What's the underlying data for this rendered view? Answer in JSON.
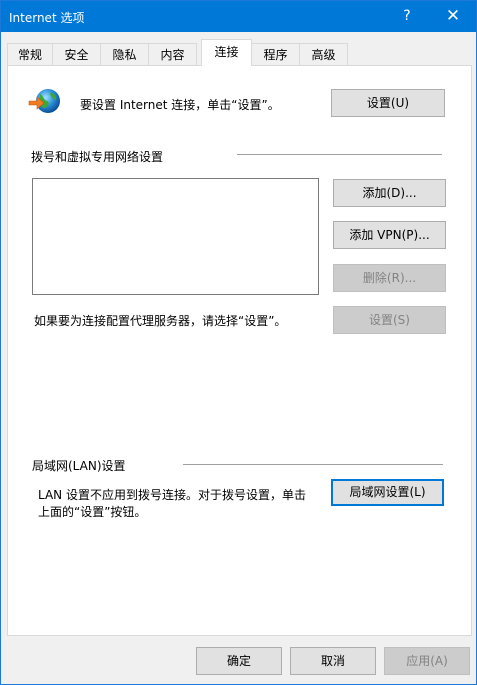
{
  "window": {
    "title": "Internet 选项",
    "help_label": "?",
    "close_label": "✕"
  },
  "tabs": [
    {
      "label": "常规"
    },
    {
      "label": "安全"
    },
    {
      "label": "隐私"
    },
    {
      "label": "内容"
    },
    {
      "label": "连接",
      "active": true
    },
    {
      "label": "程序"
    },
    {
      "label": "高级"
    }
  ],
  "setup": {
    "icon": "globe-arrow-icon",
    "text": "要设置 Internet 连接，单击“设置”。",
    "button_label": "设置(U)"
  },
  "dialup": {
    "heading": "拨号和虚拟专用网络设置",
    "add_label": "添加(D)...",
    "add_vpn_label": "添加 VPN(P)...",
    "remove_label": "删除(R)...",
    "proxy_text": "如果要为连接配置代理服务器，请选择“设置”。",
    "settings_label": "设置(S)"
  },
  "lan": {
    "heading": "局域网(LAN)设置",
    "text_line1": "LAN 设置不应用到拨号连接。对于拨号设置，单击",
    "text_line2": "上面的“设置”按钮。",
    "button_label": "局域网设置(L)"
  },
  "footer": {
    "ok_label": "确定",
    "cancel_label": "取消",
    "apply_label": "应用(A)"
  },
  "colors": {
    "titlebar": "#0078d7",
    "window_bg": "#f0f0f0",
    "panel_bg": "#ffffff"
  }
}
